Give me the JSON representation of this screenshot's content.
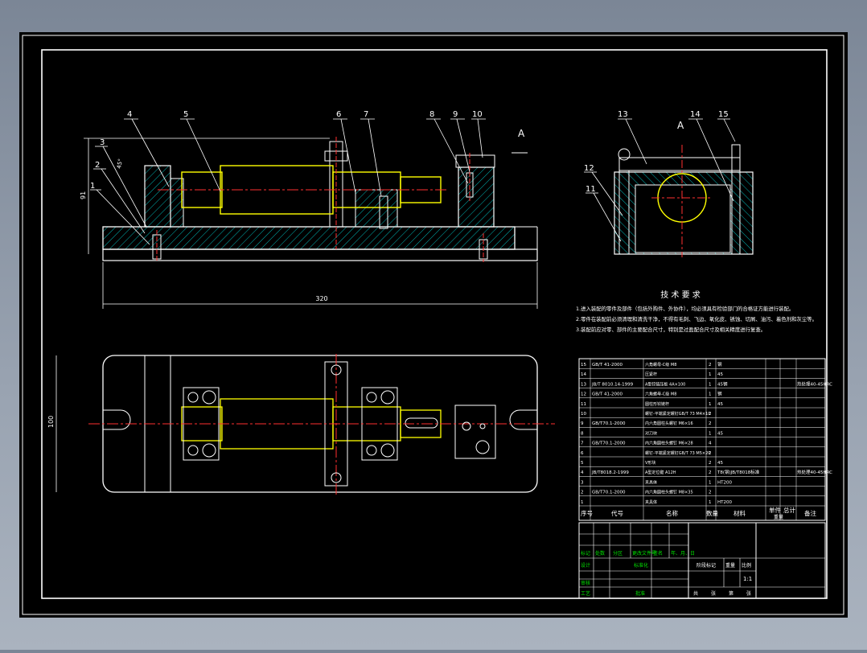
{
  "section_label": "A",
  "view_label": "A",
  "dimensions": {
    "overall_length": "320",
    "height_left": "91",
    "plan_width": "100",
    "angle_note": "45°"
  },
  "part_callouts": [
    "1",
    "2",
    "3",
    "4",
    "5",
    "6",
    "7",
    "8",
    "9",
    "10",
    "11",
    "12",
    "13",
    "14",
    "15"
  ],
  "tech_requirements": {
    "title": "技 术 要 求",
    "lines": [
      "1.进入装配的零件及部件（包括外购件、外协件），均必须具有检验部门的合格证方能进行装配。",
      "2.零件在装配前必须清理和清洗干净，不得有毛刺、飞边、氧化皮、锈蚀、切屑、油污、着色剂和灰尘等。",
      "3.装配前应对零、部件的主要配合尺寸，特别是过盈配合尺寸及相关精度进行复查。"
    ]
  },
  "bom": {
    "headers": [
      "序号",
      "代号",
      "名称",
      "数量",
      "材料",
      "单件",
      "总计",
      "备注"
    ],
    "weight_label": "重量",
    "rows": [
      {
        "no": "15",
        "code": "GB/T 41-2000",
        "name": "六角螺母-C级 M8",
        "qty": "2",
        "mat": "钢",
        "note": ""
      },
      {
        "no": "14",
        "code": "",
        "name": "压紧杆",
        "qty": "1",
        "mat": "45",
        "note": ""
      },
      {
        "no": "13",
        "code": "JB/T 8010.14-1999",
        "name": "A型铰链压板 4A×100",
        "qty": "1",
        "mat": "45钢",
        "note": "热处理40-45HRC"
      },
      {
        "no": "12",
        "code": "GB/T 41-2000",
        "name": "六角螺母-C级 M8",
        "qty": "1",
        "mat": "钢",
        "note": ""
      },
      {
        "no": "11",
        "code": "",
        "name": "圆柱形铰链杆",
        "qty": "1",
        "mat": "45",
        "note": ""
      },
      {
        "no": "10",
        "code": "",
        "name": "螺钉-平端紧定螺钉GB/T 73 M4×10",
        "qty": "2",
        "mat": "",
        "note": ""
      },
      {
        "no": "9",
        "code": "GB/T70.1-2000",
        "name": "内六角圆柱头螺钉 M6×16",
        "qty": "2",
        "mat": "",
        "note": ""
      },
      {
        "no": "8",
        "code": "",
        "name": "对刀块",
        "qty": "1",
        "mat": "45",
        "note": ""
      },
      {
        "no": "7",
        "code": "GB/T70.1-2000",
        "name": "内六角圆柱头螺钉 M6×28",
        "qty": "4",
        "mat": "",
        "note": ""
      },
      {
        "no": "6",
        "code": "",
        "name": "螺钉-平端紧定螺钉GB/T 73 M5×20",
        "qty": "2",
        "mat": "",
        "note": ""
      },
      {
        "no": "5",
        "code": "",
        "name": "V形块",
        "qty": "2",
        "mat": "45",
        "note": ""
      },
      {
        "no": "4",
        "code": "JB/T8018.2-1999",
        "name": "A型定位键 A12H",
        "qty": "2",
        "mat": "T8(钢)JB/T8018标准",
        "note": "热处理40-45HRC"
      },
      {
        "no": "3",
        "code": "",
        "name": "夹具体",
        "qty": "1",
        "mat": "HT200",
        "note": ""
      },
      {
        "no": "2",
        "code": "GB/T70.1-2000",
        "name": "内六角圆柱头螺钉 M8×35",
        "qty": "2",
        "mat": "",
        "note": ""
      },
      {
        "no": "1",
        "code": "",
        "name": "夹具体",
        "qty": "1",
        "mat": "HT200",
        "note": ""
      }
    ]
  },
  "title_block": {
    "row_labels": [
      "标记",
      "处数",
      "分区",
      "更改文件号",
      "签名",
      "年、月、日"
    ],
    "design": "设计",
    "standardize": "标准化",
    "review": "审核",
    "process": "工艺",
    "approve": "批准",
    "stage_mark": "阶段标记",
    "weight": "重量",
    "scale_label": "比例",
    "scale_value": "1:1",
    "sheets": [
      "共",
      "张",
      "第",
      "张"
    ]
  }
}
